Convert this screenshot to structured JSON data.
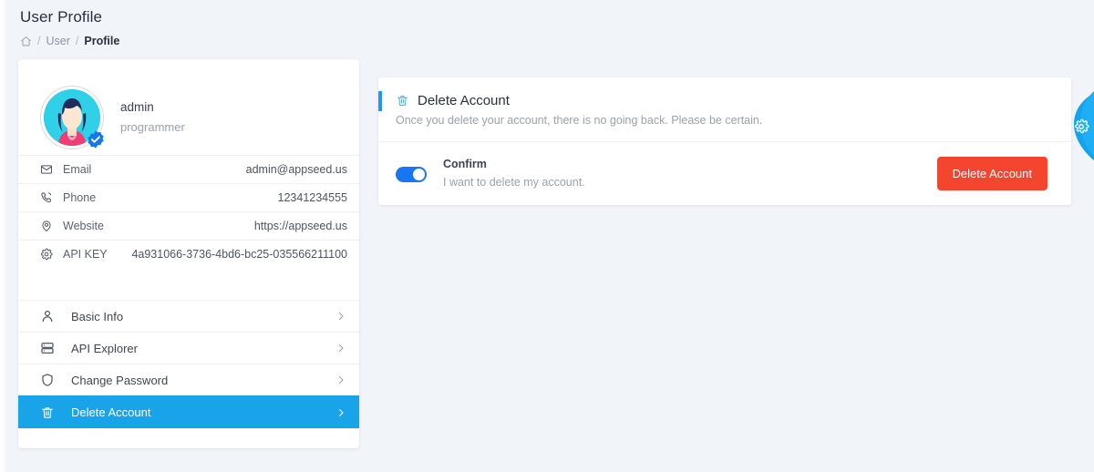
{
  "header": {
    "title": "User Profile",
    "breadcrumb": {
      "home_icon": "home-icon",
      "separator": "/",
      "items": [
        {
          "label": "User",
          "active": false
        },
        {
          "label": "Profile",
          "active": true
        }
      ]
    }
  },
  "profile": {
    "avatar_icon": "user-avatar-illustration",
    "verified_badge_icon": "verified-badge-icon",
    "name": "admin",
    "role": "programmer",
    "info_rows": [
      {
        "icon": "mail-icon",
        "label": "Email",
        "value": "admin@appseed.us"
      },
      {
        "icon": "phone-icon",
        "label": "Phone",
        "value": "12341234555"
      },
      {
        "icon": "map-pin-icon",
        "label": "Website",
        "value": "https://appseed.us"
      },
      {
        "icon": "gear-icon",
        "label": "API KEY",
        "value": "4a931066-3736-4bd6-bc25-035566211100"
      }
    ],
    "menu": [
      {
        "icon": "user-icon",
        "label": "Basic Info",
        "chevron": "chevron-right-icon",
        "active": false
      },
      {
        "icon": "server-icon",
        "label": "API Explorer",
        "chevron": "chevron-right-icon",
        "active": false
      },
      {
        "icon": "shield-icon",
        "label": "Change Password",
        "chevron": "chevron-right-icon",
        "active": false
      },
      {
        "icon": "trash-icon",
        "label": "Delete Account",
        "chevron": "chevron-right-icon",
        "active": true
      }
    ]
  },
  "delete_panel": {
    "icon": "trash-icon",
    "title": "Delete Account",
    "subtitle": "Once you delete your account, there is no going back. Please be certain.",
    "toggle": {
      "name": "confirm-toggle",
      "state": "on"
    },
    "confirm_title": "Confirm",
    "confirm_subtitle": "I want to delete my account.",
    "button_label": "Delete Account"
  },
  "settings_tab": {
    "icon": "gear-icon"
  },
  "colors": {
    "page_background": "#f1f4f9",
    "card_background": "#ffffff",
    "accent_blue": "#2196f3",
    "active_menu_blue": "#19a3e8",
    "danger_red": "#f4452e",
    "toggle_on_blue": "#1976f2",
    "muted_text": "#9aa1ae",
    "primary_text": "#2b2f3a"
  }
}
